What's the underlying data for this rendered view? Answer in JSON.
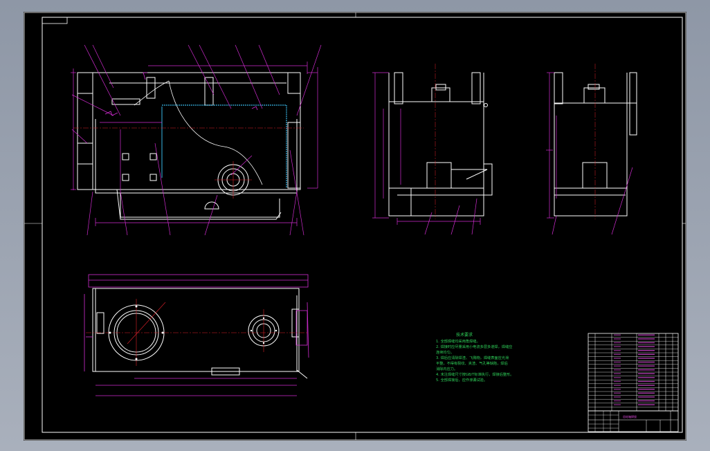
{
  "colors": {
    "background": "#000000",
    "frame": "#ffffff",
    "outline": "#ffffff",
    "dimension": "#d22cd2",
    "center": "#e0202a",
    "hidden": "#38b8e8",
    "notes": "#2fd35a"
  },
  "notes": {
    "title": "技术要求",
    "lines": [
      "1. 全部焊缝均采用角焊缝。",
      "2. 焊接时应尽量采用小电流多层多道焊，焊缝应",
      "   连续均匀。",
      "3. 焊后应清除焊渣、飞溅物，焊缝表面应光滑",
      "   平整，不得有裂纹、夹渣、气孔等缺陷，焊后",
      "   消除内应力。",
      "4. 未注焊缝尺寸按GB/T标准执行，焊接后整形。",
      "5. 全部焊接后，应作渗漏试验。"
    ]
  },
  "title_block": {
    "drawing_label": "齿轮箱焊接"
  }
}
